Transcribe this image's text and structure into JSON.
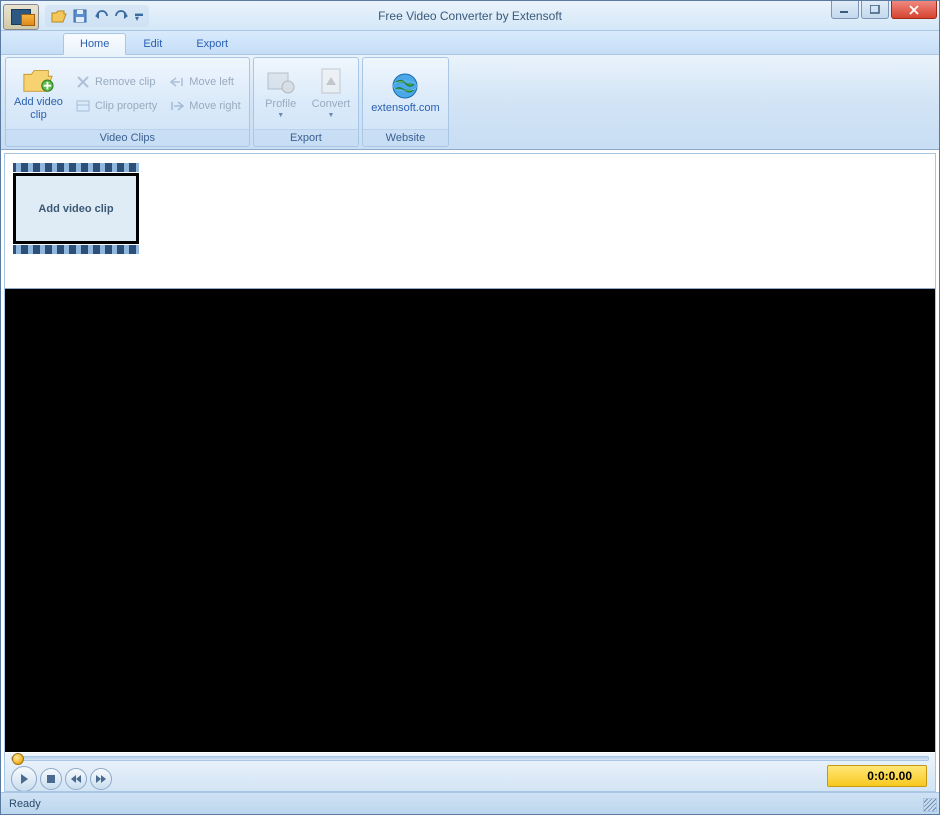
{
  "window": {
    "title": "Free Video Converter by Extensoft"
  },
  "tabs": {
    "home": "Home",
    "edit": "Edit",
    "export": "Export",
    "active": "home"
  },
  "ribbon": {
    "groups": {
      "video_clips": {
        "title": "Video Clips",
        "add_video_clip": "Add video\nclip",
        "remove_clip": "Remove clip",
        "clip_property": "Clip property",
        "move_left": "Move left",
        "move_right": "Move right"
      },
      "export": {
        "title": "Export",
        "profile": "Profile",
        "convert": "Convert"
      },
      "website": {
        "title": "Website",
        "link": "extensoft.com"
      }
    }
  },
  "clip_area": {
    "placeholder": "Add video clip"
  },
  "playback": {
    "time_display": "0:0:0.00"
  },
  "status": {
    "text": "Ready"
  }
}
